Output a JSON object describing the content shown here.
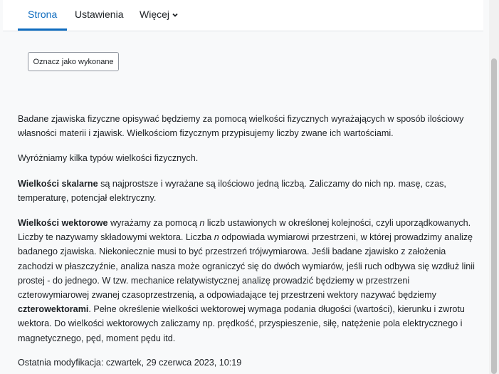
{
  "tabs": [
    {
      "label": "Strona",
      "active": true
    },
    {
      "label": "Ustawienia",
      "active": false
    },
    {
      "label": "Więcej",
      "active": false
    }
  ],
  "mark_done_label": "Oznacz jako wykonane",
  "content": {
    "p1": "Badane zjawiska fizyczne opisywać będziemy za pomocą wielkości fizycznych wyrażających w sposób ilościowy własności materii i zjawisk. Wielkościom fizycznym przypisujemy liczby zwane ich wartościami.",
    "p2": "Wyróżniamy kilka typów wielkości fizycznych.",
    "p3_bold": "Wielkości skalarne",
    "p3_rest": " są najprostsze i wyrażane są ilościowo jedną liczbą. Zaliczamy do nich np. masę, czas, temperaturę, potencjał elektryczny.",
    "p4_bold": "Wielkości wektorowe",
    "p4_a": " wyrażamy za pomocą ",
    "p4_n1": "n",
    "p4_b": " liczb ustawionych w określonej kolejności, czyli uporządkowanych. Liczby te nazywamy składowymi wektora. Liczba ",
    "p4_n2": "n",
    "p4_c": " odpowiada wymiarowi przestrzeni, w której prowadzimy analizę badanego zjawiska. Niekoniecznie musi to być przestrzeń trójwymiarowa. Jeśli badane zjawisko z założenia zachodzi w płaszczyźnie, analiza nasza może ograniczyć się do dwóch wymiarów, jeśli ruch odbywa się wzdłuż linii prostej - do jednego. W tzw. mechanice relatywistycznej analizę prowadzić będziemy w przestrzeni czterowymiarowej zwanej czasoprzestrzenią, a odpowiadające tej przestrzeni wektory nazywać będziemy ",
    "p4_bold2": "czterowektorami",
    "p4_d": ". Pełne określenie wielkości wektorowej wymaga podania długości (wartości), kierunku i zwrotu wektora. Do wielkości wektorowych zaliczamy np. prędkość, przyspieszenie, siłę, natężenie pola elektrycznego i magnetycznego, pęd, moment pędu itd."
  },
  "last_modified": "Ostatnia modyfikacja: czwartek, 29 czerwca 2023, 10:19",
  "colors": {
    "accent": "#0f6cbf",
    "text": "#1d2125",
    "background": "#f8f9fa"
  },
  "icons": {
    "more_dropdown": "chevron-down-icon"
  }
}
